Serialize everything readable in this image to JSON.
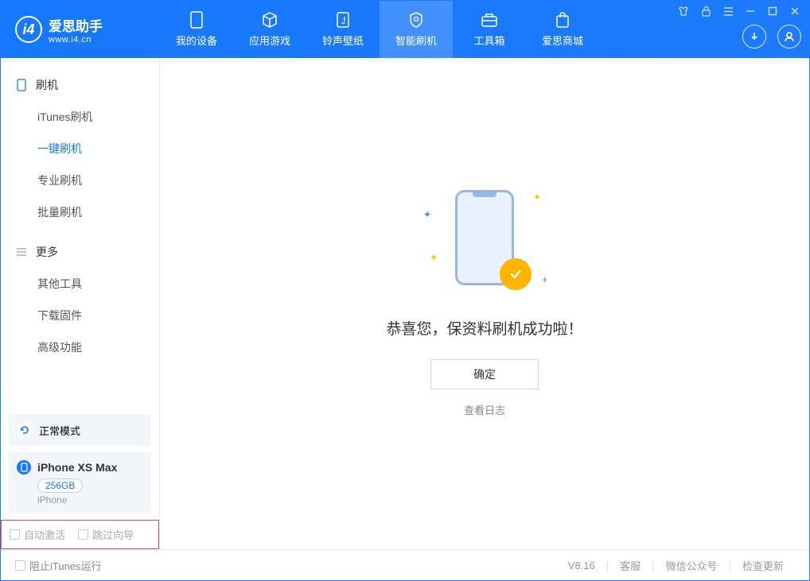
{
  "logo": {
    "title": "爱思助手",
    "sub": "www.i4.cn",
    "mark": "i4"
  },
  "nav": {
    "device": "我的设备",
    "apps": "应用游戏",
    "ring": "铃声壁纸",
    "flash": "智能刷机",
    "tools": "工具箱",
    "store": "爱思商城"
  },
  "sidebar": {
    "group_flash": "刷机",
    "items_flash": {
      "itunes": "iTunes刷机",
      "onekey": "一键刷机",
      "pro": "专业刷机",
      "batch": "批量刷机"
    },
    "group_more": "更多",
    "items_more": {
      "other": "其他工具",
      "firmware": "下载固件",
      "adv": "高级功能"
    }
  },
  "device": {
    "mode": "正常模式",
    "name": "iPhone XS Max",
    "capacity": "256GB",
    "type": "iPhone"
  },
  "options": {
    "auto_activate": "自动激活",
    "skip_guide": "跳过向导"
  },
  "main": {
    "success": "恭喜您，保资料刷机成功啦！",
    "ok": "确定",
    "log": "查看日志"
  },
  "footer": {
    "block_itunes": "阻止iTunes运行",
    "version": "V8.16",
    "service": "客服",
    "wechat": "微信公众号",
    "update": "检查更新"
  }
}
